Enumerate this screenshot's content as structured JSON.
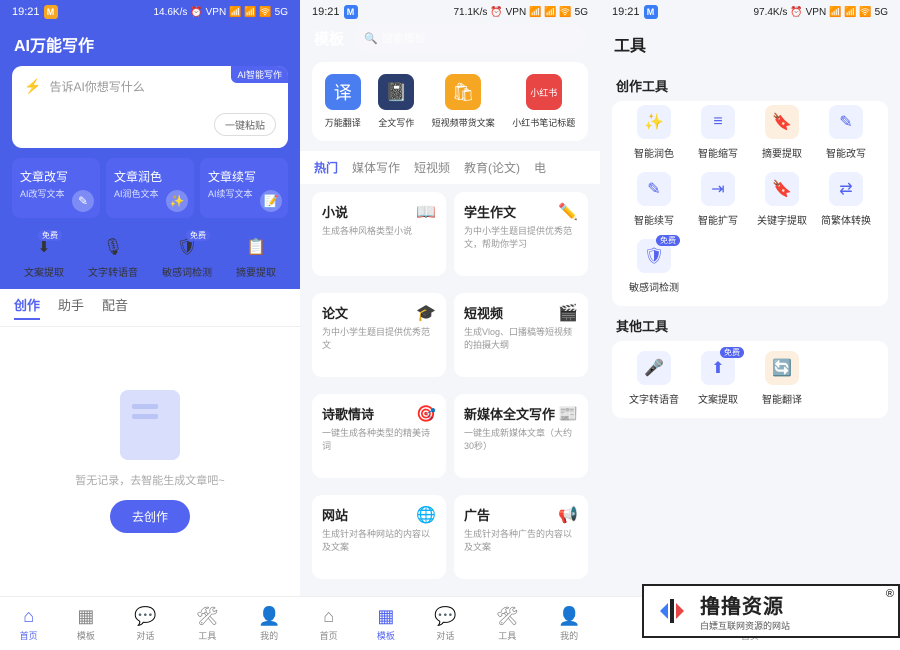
{
  "status": {
    "time": "19:21",
    "m": "M",
    "right1": "14.6K/s",
    "right2": "71.1K/s",
    "right3": "97.4K/s",
    "icons": "⏰ VPN 📶 📶 🛜 5G"
  },
  "p1": {
    "title": "AI万能写作",
    "prompt_placeholder": "告诉AI你想写什么",
    "ai_badge": "AI智能写作",
    "paste_btn": "一键粘贴",
    "action_cards": [
      {
        "title": "文章改写",
        "sub": "AI改写文本"
      },
      {
        "title": "文章润色",
        "sub": "AI润色文本"
      },
      {
        "title": "文章续写",
        "sub": "AI续写文本"
      }
    ],
    "tools": [
      {
        "label": "文案提取",
        "free": "免费"
      },
      {
        "label": "文字转语音"
      },
      {
        "label": "敏感词检测",
        "free": "免费"
      },
      {
        "label": "摘要提取"
      }
    ],
    "tabs": [
      "创作",
      "助手",
      "配音"
    ],
    "empty_text": "暂无记录，去智能生成文章吧~",
    "create_btn": "去创作"
  },
  "p2": {
    "header": "模板",
    "search_placeholder": "搜索模板",
    "features": [
      {
        "label": "万能翻译",
        "icon": "译"
      },
      {
        "label": "全文写作",
        "icon": "📓"
      },
      {
        "label": "短视频带货文案",
        "icon": "🛍"
      },
      {
        "label": "小红书笔记标题",
        "icon": "小红书"
      }
    ],
    "cat_tabs": [
      "热门",
      "媒体写作",
      "短视频",
      "教育(论文)",
      "电"
    ],
    "cards": [
      {
        "name": "小说",
        "desc": "生成各种风格类型小说",
        "icon": "📖"
      },
      {
        "name": "学生作文",
        "desc": "为中小学生题目提供优秀范文，帮助你学习",
        "icon": "✏️"
      },
      {
        "name": "论文",
        "desc": "为中小学生题目提供优秀范文",
        "icon": "🎓"
      },
      {
        "name": "短视频",
        "desc": "生成Vlog、口播稿等短视频的拍摄大纲",
        "icon": "🎬"
      },
      {
        "name": "诗歌情诗",
        "desc": "一键生成各种类型的精美诗词",
        "icon": "🎯"
      },
      {
        "name": "新媒体全文写作",
        "desc": "一键生成新媒体文章（大约30秒）",
        "icon": "📰"
      },
      {
        "name": "网站",
        "desc": "生成针对各种网站的内容以及文案",
        "icon": "🌐"
      },
      {
        "name": "广告",
        "desc": "生成针对各种广告的内容以及文案",
        "icon": "📢"
      }
    ]
  },
  "p3": {
    "title": "工具",
    "section1": "创作工具",
    "tools1": [
      {
        "label": "智能润色",
        "icon": "✨"
      },
      {
        "label": "智能缩写",
        "icon": "≡"
      },
      {
        "label": "摘要提取",
        "icon": "🔖",
        "orange": true
      },
      {
        "label": "智能改写",
        "icon": "✎"
      },
      {
        "label": "智能续写",
        "icon": "✎"
      },
      {
        "label": "智能扩写",
        "icon": "⇥"
      },
      {
        "label": "关键字提取",
        "icon": "🔖"
      },
      {
        "label": "简繁体转换",
        "icon": "⇄"
      },
      {
        "label": "敏感词检测",
        "icon": "🛡",
        "free": "免费"
      }
    ],
    "section2": "其他工具",
    "tools2": [
      {
        "label": "文字转语音",
        "icon": "🎤"
      },
      {
        "label": "文案提取",
        "icon": "⬆",
        "free": "免费"
      },
      {
        "label": "智能翻译",
        "icon": "🔄",
        "orange": true
      }
    ]
  },
  "nav": [
    "首页",
    "模板",
    "对话",
    "工具",
    "我的"
  ],
  "watermark": {
    "t1": "撸撸资源",
    "t2": "白嫖互联网资源的网站",
    "r": "®"
  }
}
